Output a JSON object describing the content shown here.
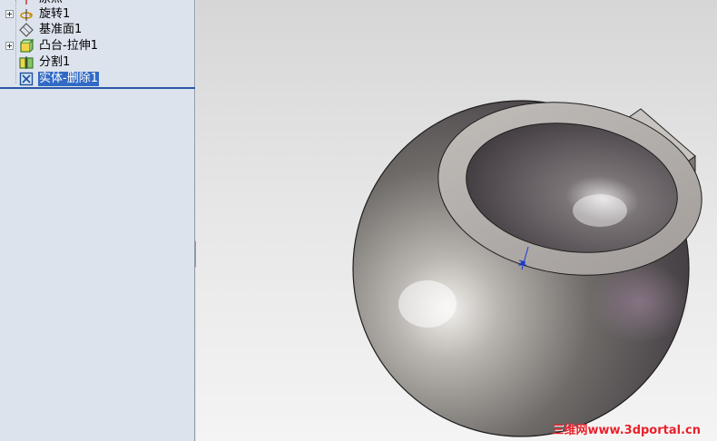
{
  "feature_tree": {
    "items": [
      {
        "label": "原点",
        "icon": "origin-icon",
        "expandable": false
      },
      {
        "label": "旋转1",
        "icon": "revolve-icon",
        "expandable": true
      },
      {
        "label": "基准面1",
        "icon": "plane-icon",
        "expandable": false
      },
      {
        "label": "凸台-拉伸1",
        "icon": "extrude-icon",
        "expandable": true
      },
      {
        "label": "分割1",
        "icon": "split-icon",
        "expandable": false
      },
      {
        "label": "实体-删除1",
        "icon": "delete-body-icon",
        "expandable": false,
        "selected": true
      }
    ]
  },
  "viewport": {
    "model": "sphere-with-boss",
    "watermark": "三维网www.3dportal.cn"
  },
  "colors": {
    "selection": "#316ac5",
    "panel_bg": "#dde3ed",
    "watermark": "#e8202a"
  }
}
